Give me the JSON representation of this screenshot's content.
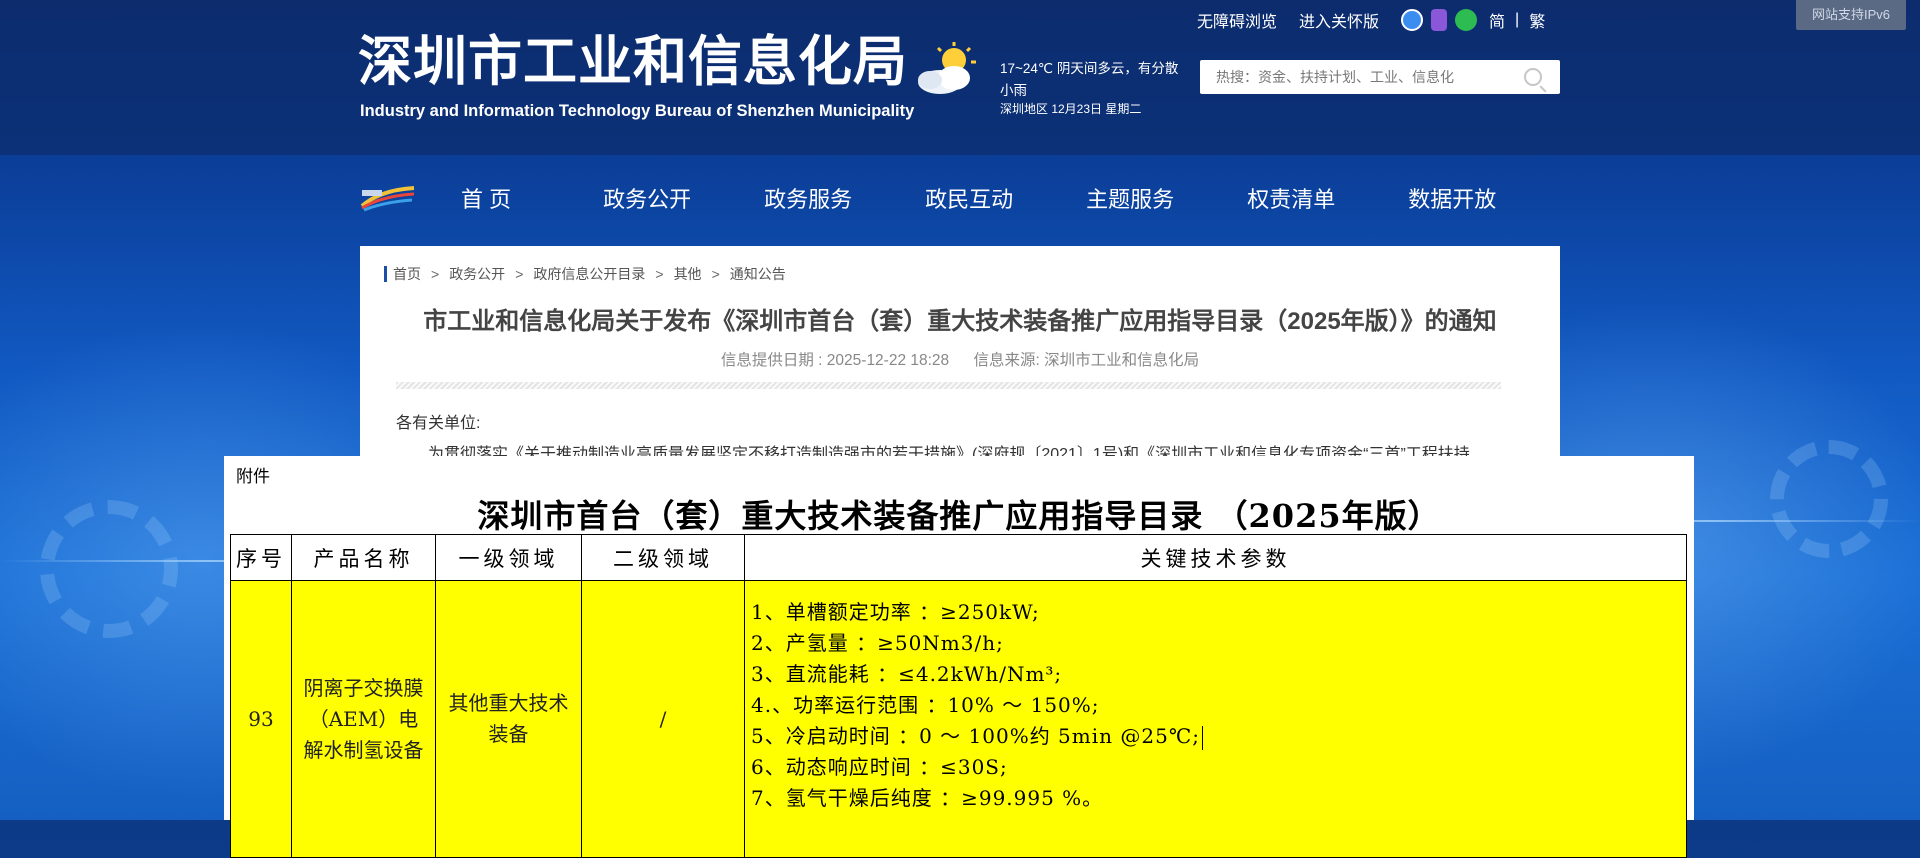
{
  "header": {
    "ipv6_badge": "网站支持IPv6",
    "accessibility_link": "无障碍浏览",
    "care_mode_link": "进入关怀版",
    "lang_simplified": "简",
    "lang_separator": "|",
    "lang_traditional": "繁",
    "site_title": "深圳市工业和信息化局",
    "site_subtitle": "Industry and Information Technology Bureau of Shenzhen Municipality",
    "weather": {
      "line1": "17~24℃  阴天间多云，有分散",
      "line2": "小雨",
      "line3": "深圳地区 12月23日  星期二"
    },
    "search_placeholder": "热搜：资金、扶持计划、工业、信息化"
  },
  "nav": {
    "items": [
      "首 页",
      "政务公开",
      "政务服务",
      "政民互动",
      "主题服务",
      "权责清单",
      "数据开放"
    ]
  },
  "article": {
    "breadcrumb": [
      "首页",
      "政务公开",
      "政府信息公开目录",
      "其他",
      "通知公告"
    ],
    "breadcrumb_sep": ">",
    "title": "市工业和信息化局关于发布《深圳市首台（套）重大技术装备推广应用指导目录（2025年版）》的通知",
    "meta_date": "信息提供日期 : 2025-12-22 18:28",
    "meta_source": "信息来源:   深圳市工业和信息化局",
    "greeting": "各有关单位:",
    "paragraph": "为贯彻落实《关于推动制造业高质量发展坚定不移打造制造强市的若干措施》(深府规〔2021〕1号)和《深圳市工业和信息化专项资金“三首”工程扶持"
  },
  "attachment": {
    "label": "附件",
    "title": "深圳市首台（套）重大技术装备推广应用指导目录 （2025年版）",
    "columns": [
      "序号",
      "产品名称",
      "一级领域",
      "二级领域",
      "关键技术参数"
    ],
    "row": {
      "index": "93",
      "product": "阴离子交换膜（AEM）电解水制氢设备",
      "level1": "其他重大技术装备",
      "level2": "/",
      "params": [
        "1、单槽额定功率 ：≥250kW;",
        "2、产氢量 ：≥50Nm3/h;",
        "3、直流能耗 ：≤4.2kWh/Nm³;",
        "4.、功率运行范围 ：10% ～ 150%;",
        "5、冷启动时间 ：0 ～ 100%约 5min @25℃;",
        "6、动态响应时间 ：≤30S;",
        "7、氢气干燥后纯度 ：≥99.995 %。"
      ]
    }
  },
  "colors": {
    "header_bg": "#0c2c6e",
    "body_blue": "#1159c2",
    "highlight_yellow": "#ffff00",
    "breadcrumb_bar": "#1b4ea8"
  }
}
